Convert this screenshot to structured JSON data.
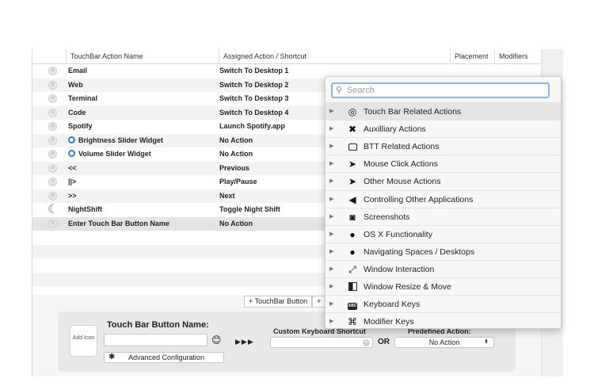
{
  "table": {
    "headers": {
      "name": "TouchBar Action Name",
      "action": "Assigned Action / Shortcut",
      "placement": "Placement",
      "modifiers": "Modifiers"
    },
    "rows": [
      {
        "name": "Email",
        "action": "Switch To Desktop 1",
        "icon": "drag-handle"
      },
      {
        "name": "Web",
        "action": "Switch To Desktop 2",
        "icon": "drag-handle"
      },
      {
        "name": "Terminal",
        "action": "Switch To Desktop 3",
        "icon": "drag-handle"
      },
      {
        "name": "Code",
        "action": "Switch To Desktop 4",
        "icon": "drag-handle"
      },
      {
        "name": "Spotify",
        "action": "Launch Spotify.app",
        "icon": "drag-handle"
      },
      {
        "name": "Brightness Slider Widget",
        "action": "No Action",
        "icon": "drag-handle"
      },
      {
        "name": "Volume Slider Widget",
        "action": "No Action",
        "icon": "drag-handle"
      },
      {
        "name": "<<",
        "action": "Previous",
        "icon": "drag-handle"
      },
      {
        "name": "||>",
        "action": "Play/Pause",
        "icon": "drag-handle"
      },
      {
        "name": ">>",
        "action": "Next",
        "icon": "drag-handle"
      },
      {
        "name": "NightShift",
        "action": "Toggle Night Shift",
        "icon": "moon-icon"
      },
      {
        "name": "Enter Touch Bar Button Name",
        "action": "No Action",
        "icon": "drag-handle"
      }
    ]
  },
  "toolbar": {
    "add_button": "+ TouchBar Button",
    "second_button": "+"
  },
  "config": {
    "add_icon_label": "Add Icon",
    "name_title": "Touch Bar Button Name:",
    "name_value": "",
    "arrows": "▶▶▶",
    "keyboard_title": "Custom Keyboard Shortcut",
    "or_label": "OR",
    "predefined_title": "Predefined Action:",
    "predefined_value": "No Action",
    "advanced_label": "Advanced Configuration"
  },
  "popup": {
    "search_placeholder": "Search",
    "items": [
      {
        "label": "Touch Bar Related Actions",
        "icon": "touchbar-icon"
      },
      {
        "label": "Auxilliary Actions",
        "icon": "tools-icon"
      },
      {
        "label": "BTT Related Actions",
        "icon": "btt-icon"
      },
      {
        "label": "Mouse Click Actions",
        "icon": "cursor-icon"
      },
      {
        "label": "Other Mouse Actions",
        "icon": "cursor-icon"
      },
      {
        "label": "Controlling Other Applications",
        "icon": "megaphone-icon"
      },
      {
        "label": "Screenshots",
        "icon": "camera-icon"
      },
      {
        "label": "OS X Functionality",
        "icon": "apple-icon"
      },
      {
        "label": "Navigating Spaces / Desktops",
        "icon": "apple-icon"
      },
      {
        "label": "Window Interaction",
        "icon": "resize-arrows-icon"
      },
      {
        "label": "Window Resize & Move",
        "icon": "half-window-icon"
      },
      {
        "label": "Keyboard Keys",
        "icon": "abc-key-icon"
      },
      {
        "label": "Modifier Keys",
        "icon": "command-icon"
      }
    ]
  }
}
